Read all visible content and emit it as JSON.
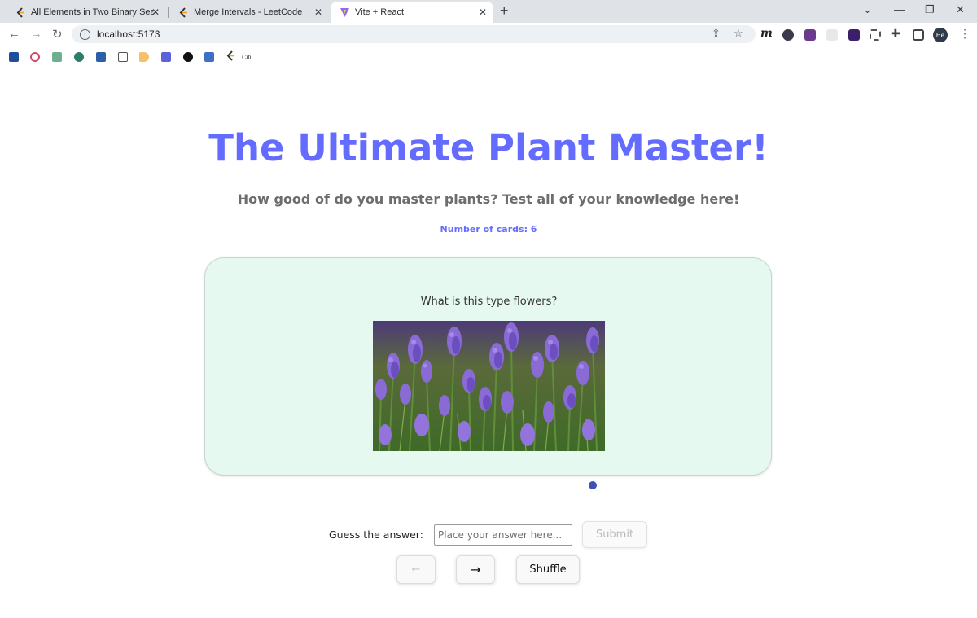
{
  "browser": {
    "tabs": [
      {
        "title": "All Elements in Two Binary Sea",
        "active": false
      },
      {
        "title": "Merge Intervals - LeetCode",
        "active": false
      },
      {
        "title": "Vite + React",
        "active": true
      }
    ],
    "url": "localhost:5173",
    "profile_initials": "He",
    "bookmark_text": "Citi"
  },
  "page": {
    "title": "The Ultimate Plant Master!",
    "subtitle": "How good of do you master plants? Test all of your knowledge here!",
    "card_count": "Number of cards: 6",
    "card": {
      "question": "What is this type flowers?",
      "image": "lavender-field-photo"
    },
    "guess": {
      "label": "Guess the answer:",
      "placeholder": "Place your answer here...",
      "value": "",
      "submit_label": "Submit"
    },
    "nav": {
      "prev_label": "←",
      "next_label": "→",
      "shuffle_label": "Shuffle"
    }
  },
  "colors": {
    "accent": "#646cff",
    "card_bg": "#e6f9f0",
    "dot": "#3f51b5"
  }
}
